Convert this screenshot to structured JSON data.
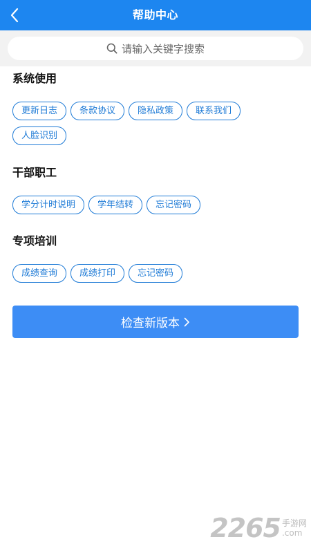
{
  "header": {
    "title": "帮助中心",
    "back_icon": "chevron-left-icon"
  },
  "search": {
    "placeholder": "请输入关键字搜索",
    "icon": "search-icon"
  },
  "sections": [
    {
      "title": "系统使用",
      "tags": [
        "更新日志",
        "条款协议",
        "隐私政策",
        "联系我们",
        "人脸识别"
      ]
    },
    {
      "title": "干部职工",
      "tags": [
        "学分计时说明",
        "学年结转",
        "忘记密码"
      ]
    },
    {
      "title": "专项培训",
      "tags": [
        "成绩查询",
        "成绩打印",
        "忘记密码"
      ]
    }
  ],
  "check_update": {
    "label": "检查新版本",
    "icon": "chevron-right-icon"
  },
  "watermark": {
    "number": "2265",
    "text": "手游网",
    "url": ".com"
  },
  "colors": {
    "header_bg": "#1d86f0",
    "tag_border": "#1d7ad6",
    "button_bg": "#3d8df5"
  }
}
